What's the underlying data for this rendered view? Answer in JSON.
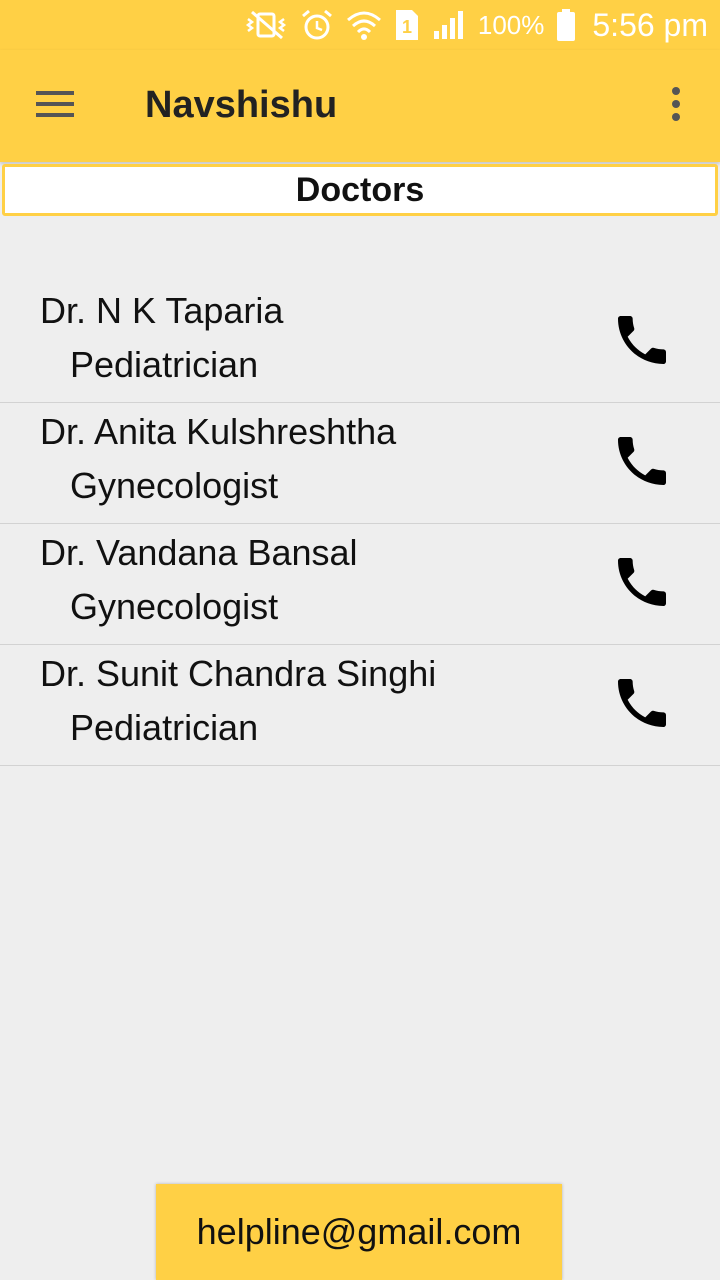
{
  "status_bar": {
    "battery_percent": "100%",
    "time": "5:56 pm",
    "sim_slot": "1",
    "icons": [
      "vibrate-off-icon",
      "alarm-icon",
      "wifi-icon",
      "sim-icon",
      "signal-icon",
      "battery-icon"
    ]
  },
  "app_bar": {
    "title": "Navshishu",
    "menu_icon": "hamburger-menu-icon",
    "overflow_icon": "more-vert-icon"
  },
  "section": {
    "title": "Doctors"
  },
  "doctors": [
    {
      "name": "Dr. N K Taparia",
      "specialty": "Pediatrician",
      "action_icon": "phone-icon"
    },
    {
      "name": "Dr. Anita Kulshreshtha",
      "specialty": "Gynecologist",
      "action_icon": "phone-icon"
    },
    {
      "name": "Dr. Vandana Bansal",
      "specialty": "Gynecologist",
      "action_icon": "phone-icon"
    },
    {
      "name": "Dr. Sunit Chandra Singhi",
      "specialty": "Pediatrician",
      "action_icon": "phone-icon"
    }
  ],
  "footer": {
    "helpline": "helpline@gmail.com"
  },
  "colors": {
    "accent": "#ffd045",
    "background": "#eeeeee",
    "text": "#111111"
  }
}
